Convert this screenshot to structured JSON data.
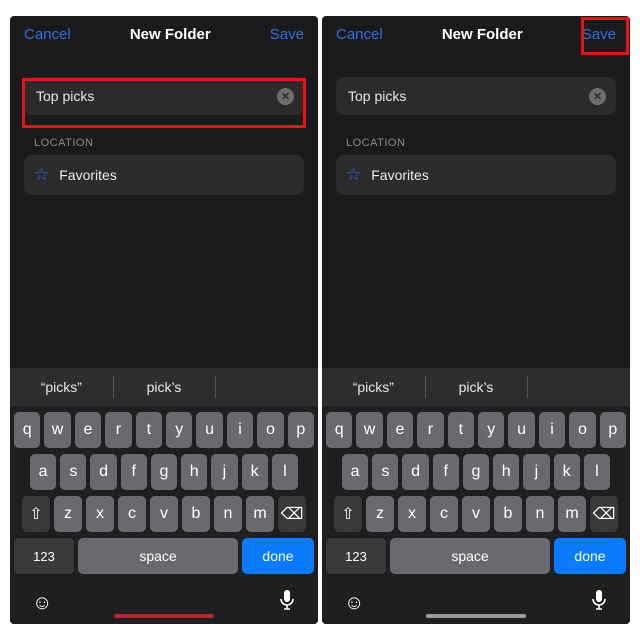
{
  "nav": {
    "cancel": "Cancel",
    "title": "New Folder",
    "save": "Save"
  },
  "field": {
    "value": "Top picks"
  },
  "location": {
    "header": "LOCATION",
    "favorites": "Favorites"
  },
  "suggestions": [
    "“picks”",
    "pick’s",
    ""
  ],
  "keyboard": {
    "row1": [
      "q",
      "w",
      "e",
      "r",
      "t",
      "y",
      "u",
      "i",
      "o",
      "p"
    ],
    "row2": [
      "a",
      "s",
      "d",
      "f",
      "g",
      "h",
      "j",
      "k",
      "l"
    ],
    "row3": [
      "z",
      "x",
      "c",
      "v",
      "b",
      "n",
      "m"
    ],
    "numbers": "123",
    "space": "space",
    "done": "done"
  },
  "highlights": {
    "left": {
      "target": "input-field"
    },
    "right": {
      "target": "save-button"
    }
  }
}
